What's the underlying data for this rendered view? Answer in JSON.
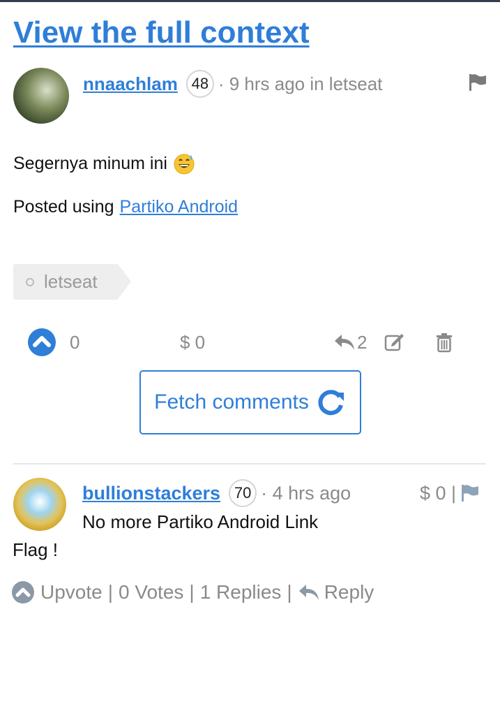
{
  "header": {
    "title": "View the full context"
  },
  "post": {
    "author": "nnaachlam",
    "reputation": "48",
    "meta": "· 9 hrs ago in letseat",
    "body_text": "Segernya minum ini",
    "emoji": "grinning-face-with-sweat-emoji",
    "posted_prefix": "Posted using",
    "posted_link": "Partiko Android",
    "tag": "letseat",
    "votes": "0",
    "payout": "$ 0",
    "replies": "2"
  },
  "fetch_comments": {
    "label": "Fetch comments"
  },
  "comment": {
    "author": "bullionstackers",
    "reputation": "70",
    "meta": "· 4 hrs ago",
    "payout": "$ 0 |",
    "text_line1": "No more Partiko Android Link",
    "text_line2": "Flag !",
    "upvote_label": "Upvote",
    "votes": "0 Votes",
    "replies": "1 Replies",
    "reply_label": "Reply",
    "separator": "|"
  },
  "colors": {
    "link": "#2f7ed8",
    "muted": "#8a8a8a",
    "border": "#d5d5d5"
  }
}
